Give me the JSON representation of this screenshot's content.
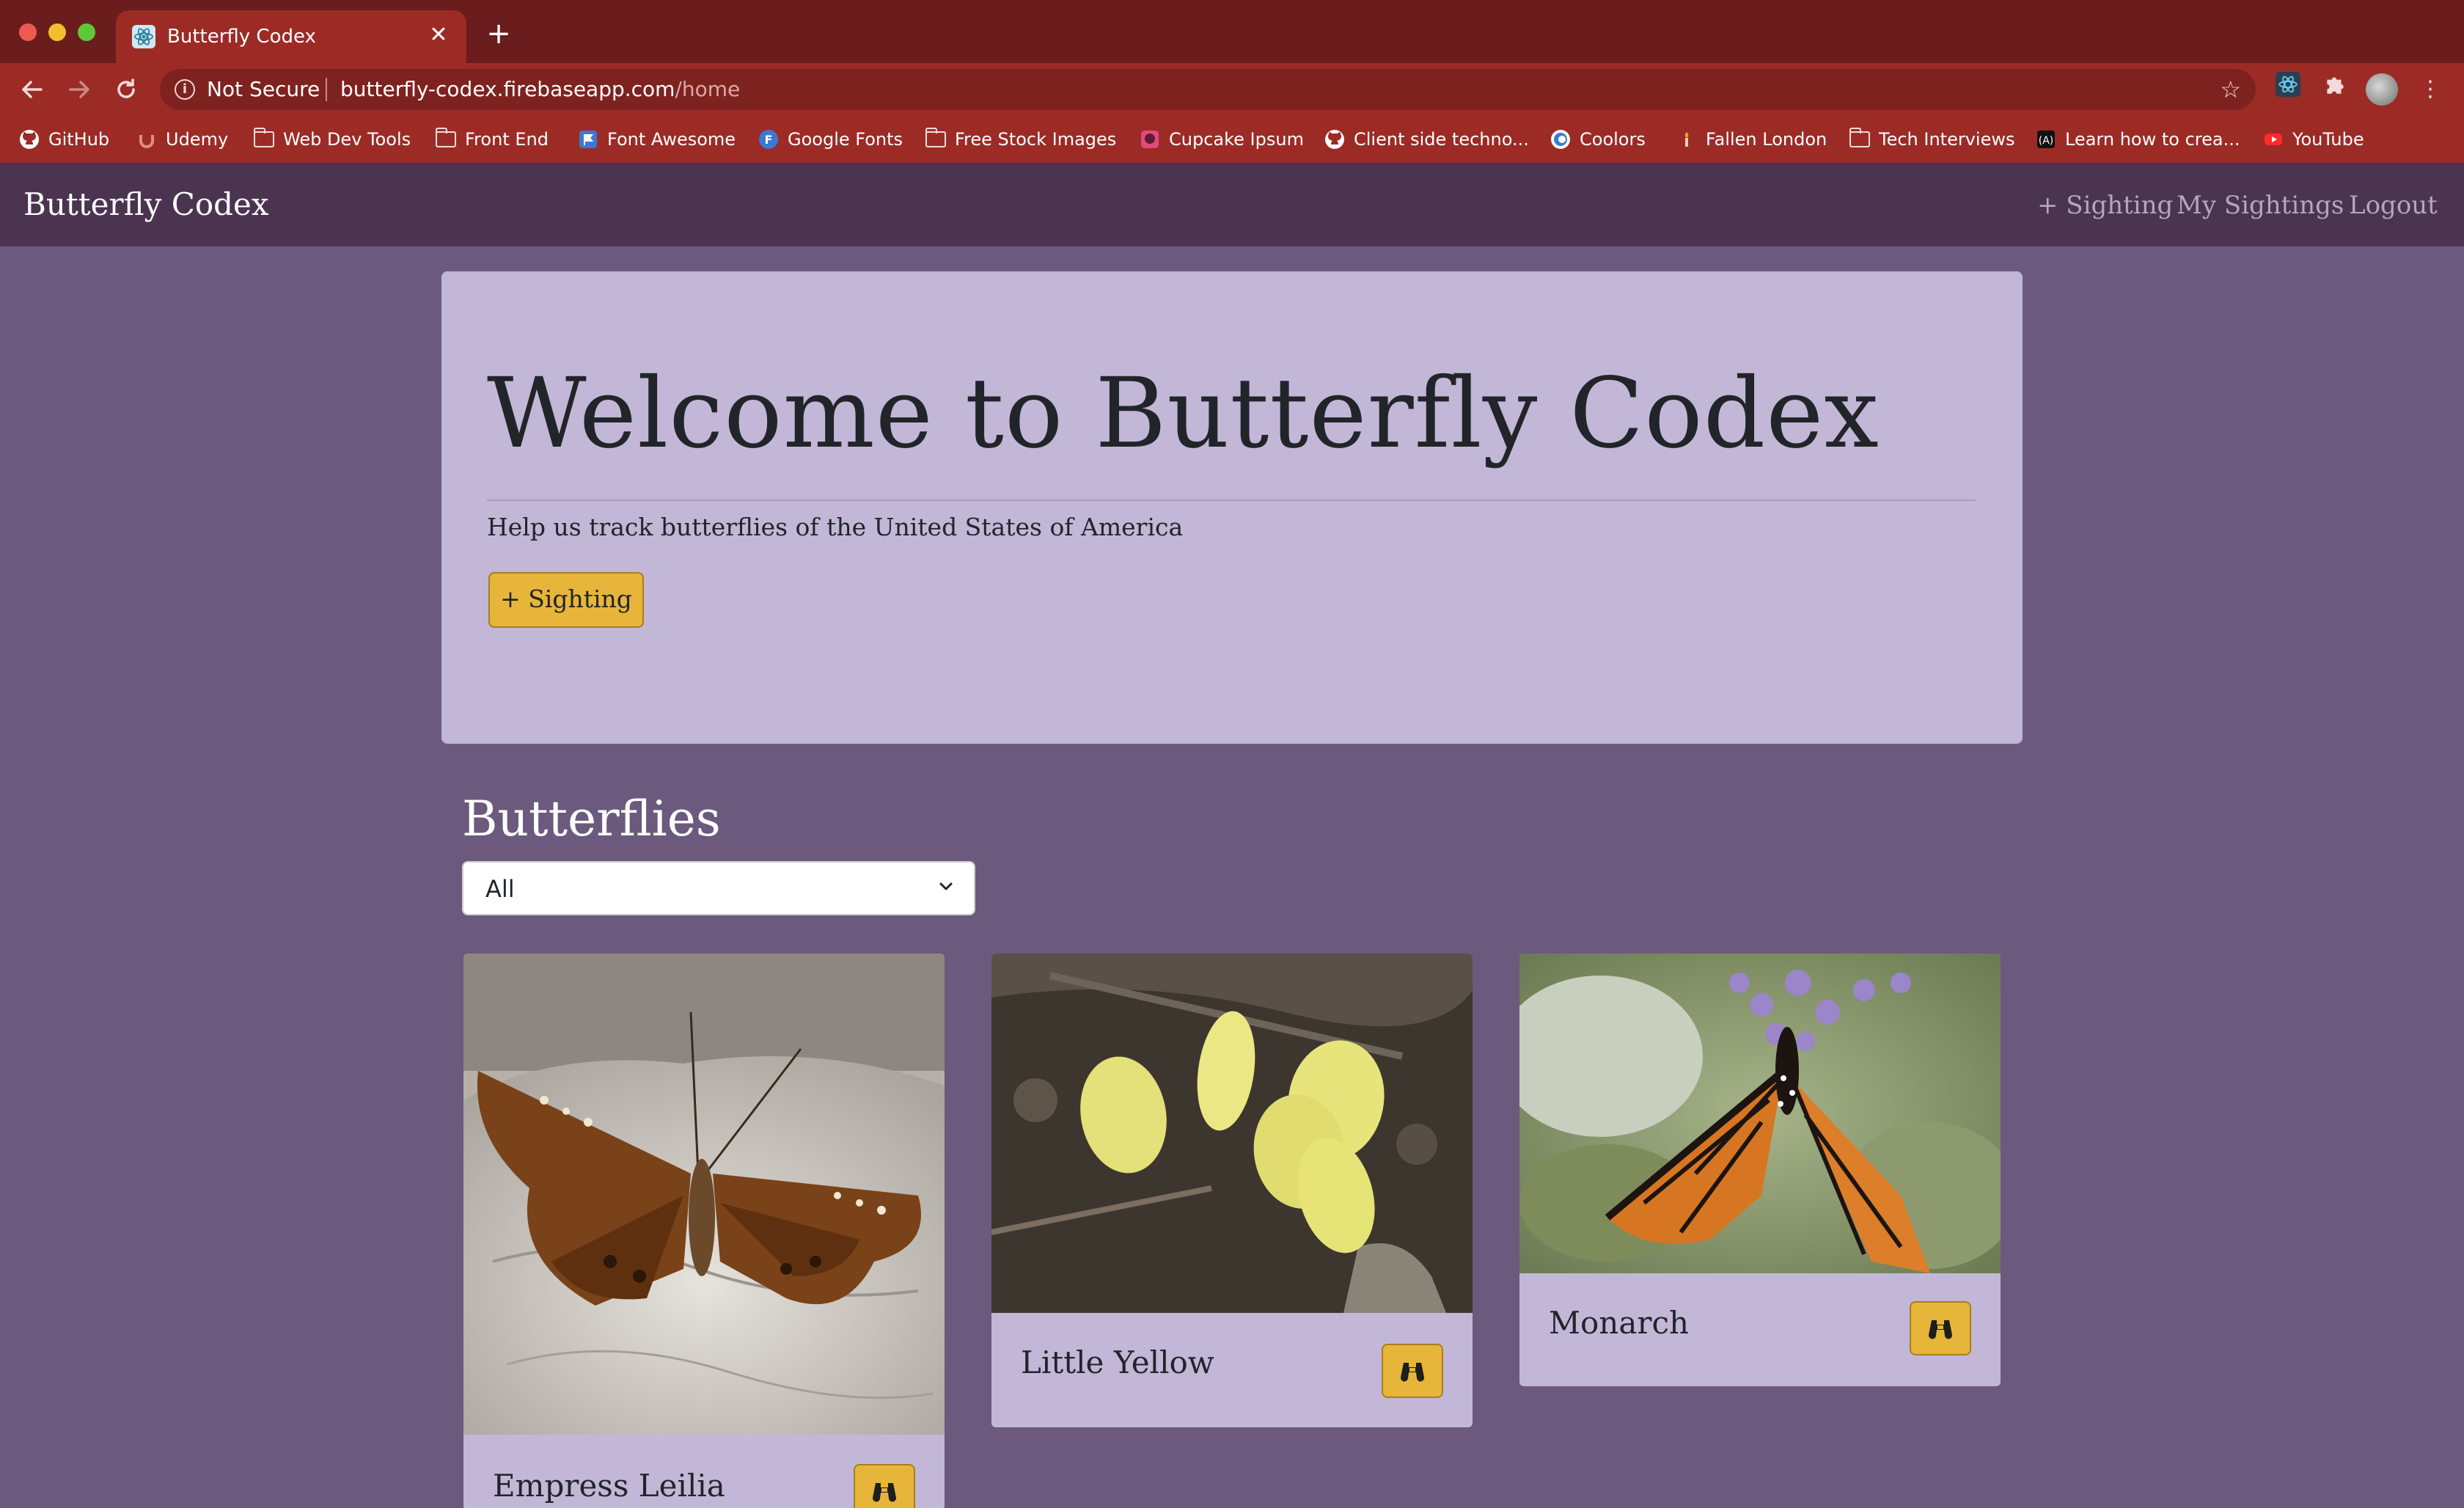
{
  "browser": {
    "tab_title": "Butterfly Codex",
    "new_tab_label": "+",
    "close_label": "✕",
    "security_label": "Not Secure",
    "url_host": "butterfly-codex.firebaseapp.com",
    "url_path": "/home",
    "bookmarks": [
      {
        "label": "GitHub",
        "icon": "github-icon"
      },
      {
        "label": "Udemy",
        "icon": "udemy-icon"
      },
      {
        "label": "Web Dev Tools",
        "icon": "folder-icon"
      },
      {
        "label": "Front End",
        "icon": "folder-icon"
      },
      {
        "label": "Font Awesome",
        "icon": "flag-icon"
      },
      {
        "label": "Google Fonts",
        "icon": "google-fonts-icon"
      },
      {
        "label": "Free Stock Images",
        "icon": "folder-icon"
      },
      {
        "label": "Cupcake Ipsum",
        "icon": "cupcake-icon"
      },
      {
        "label": "Client side techno...",
        "icon": "github-icon"
      },
      {
        "label": "Coolors",
        "icon": "coolors-icon"
      },
      {
        "label": "Fallen London",
        "icon": "candle-icon"
      },
      {
        "label": "Tech Interviews",
        "icon": "folder-icon"
      },
      {
        "label": "Learn how to crea...",
        "icon": "angular-icon"
      },
      {
        "label": "YouTube",
        "icon": "youtube-icon"
      }
    ]
  },
  "nav": {
    "brand": "Butterfly Codex",
    "links": [
      "+ Sighting",
      "My Sightings",
      "Logout"
    ]
  },
  "hero": {
    "heading": "Welcome to Butterfly Codex",
    "subtitle": "Help us track butterflies of the United States of America",
    "button": "+ Sighting"
  },
  "butterflies": {
    "title": "Butterflies",
    "filter_value": "All",
    "cards": [
      {
        "name": "Empress Leilia",
        "icon": "binoculars-icon"
      },
      {
        "name": "Little Yellow",
        "icon": "binoculars-icon"
      },
      {
        "name": "Monarch",
        "icon": "binoculars-icon"
      }
    ]
  },
  "colors": {
    "chrome": "#9c2b26",
    "navbar": "#4a3450",
    "page": "#6b5a7d",
    "jumbotron": "#c3b7d8",
    "accent": "#e7b53a"
  }
}
